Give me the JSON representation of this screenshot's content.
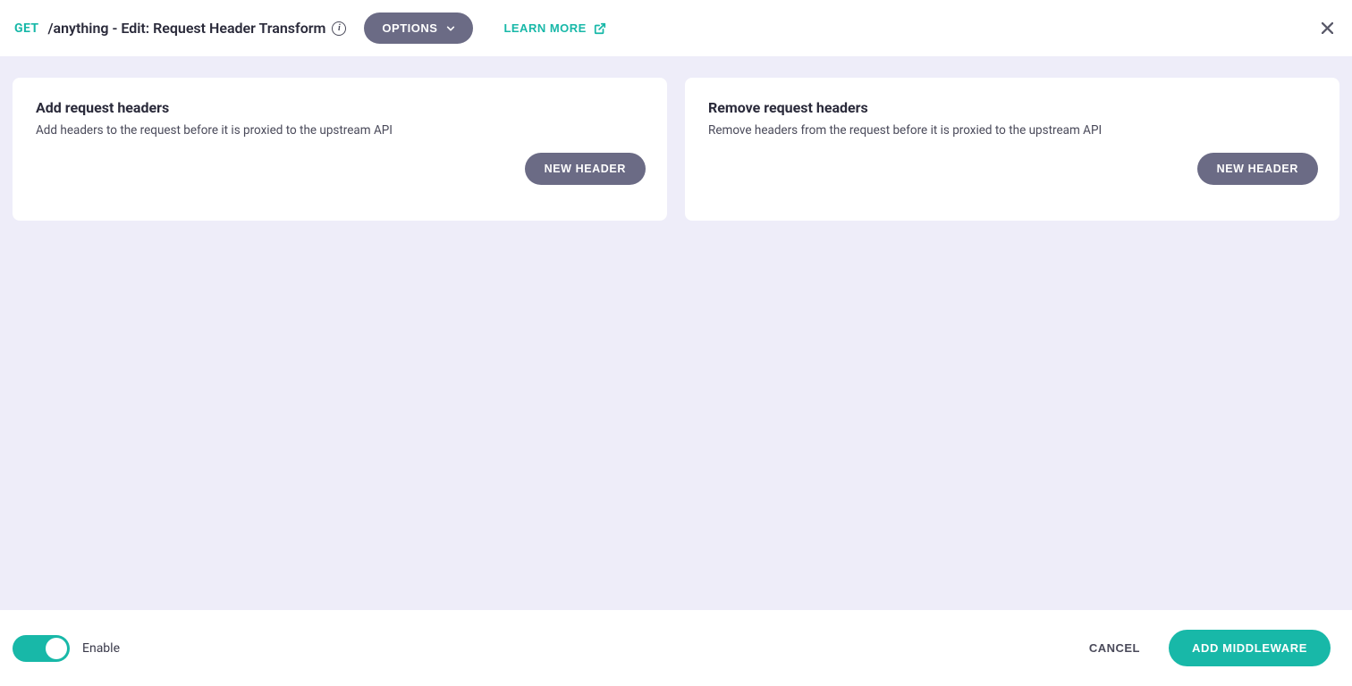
{
  "header": {
    "method": "GET",
    "title": "/anything - Edit: Request Header Transform",
    "options_label": "OPTIONS",
    "learn_more_label": "LEARN MORE"
  },
  "cards": {
    "add": {
      "title": "Add request headers",
      "desc": "Add headers to the request before it is proxied to the upstream API",
      "button_label": "NEW HEADER"
    },
    "remove": {
      "title": "Remove request headers",
      "desc": "Remove headers from the request before it is proxied to the upstream API",
      "button_label": "NEW HEADER"
    }
  },
  "footer": {
    "toggle_label": "Enable",
    "toggle_on": true,
    "cancel_label": "CANCEL",
    "add_middleware_label": "ADD MIDDLEWARE"
  },
  "colors": {
    "teal": "#18b8a8",
    "gray_button": "#6b6b85",
    "bg_lavender": "#eeedf9"
  }
}
